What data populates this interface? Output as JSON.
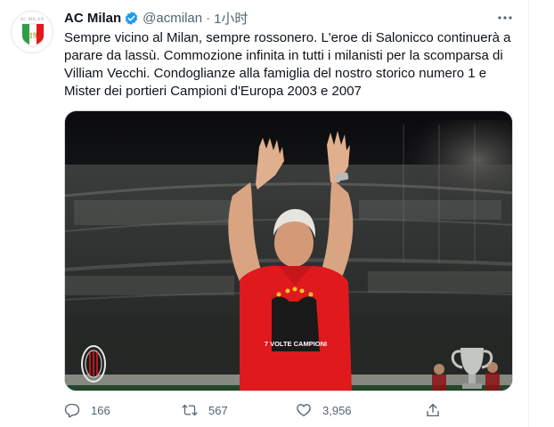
{
  "tweet": {
    "author_name": "AC Milan",
    "handle": "@acmilan",
    "separator": "·",
    "time": "1小时",
    "avatar_title": "AC MILAN",
    "avatar_number": "19",
    "text_lines": [
      "Sempre vicino al Milan, sempre rossonero. L'eroe di Salonicco continuerà a",
      "parare da lassù. Commozione infinita in tutti i milanisti per la scomparsa di",
      "Villiam Vecchi. Condoglianze alla famiglia del nostro storico numero 1 e",
      "Mister dei portieri Campioni d'Europa 2003 e 2007"
    ],
    "shirt_text": "7 VOLTE CAMPIONI",
    "actions": {
      "reply_count": "166",
      "retweet_count": "567",
      "like_count": "3,956"
    }
  },
  "icons": {
    "verified": "verified-badge-icon",
    "more": "more-options-icon",
    "reply": "reply-icon",
    "retweet": "retweet-icon",
    "like": "like-icon",
    "share": "share-icon",
    "club_crest": "ac-milan-crest-icon",
    "trophy": "champions-league-trophy-icon"
  },
  "colors": {
    "text_primary": "#0f1419",
    "text_secondary": "#536471",
    "verified_blue": "#1d9bf0",
    "milan_red": "#e0191c",
    "italian_green": "#2e9e47"
  }
}
